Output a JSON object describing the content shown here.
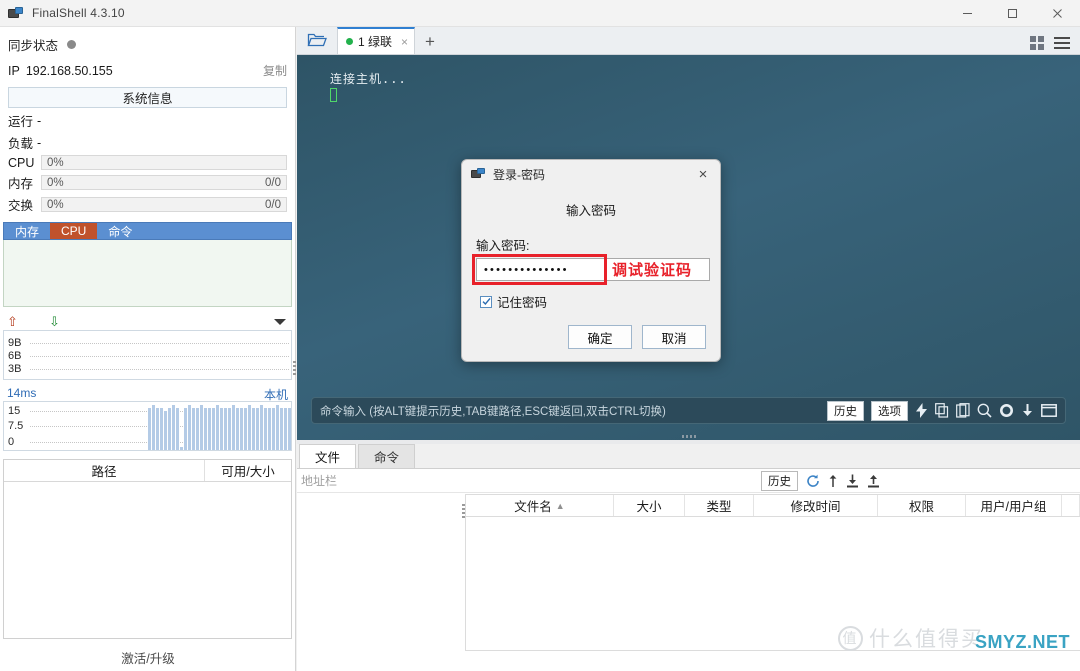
{
  "window": {
    "title": "FinalShell 4.3.10",
    "minimize_label": "minimize",
    "maximize_label": "maximize",
    "close_label": "close"
  },
  "sidebar": {
    "sync_label": "同步状态",
    "ip_prefix": "IP",
    "ip_value": "192.168.50.155",
    "copy_label": "复制",
    "sysinfo_button": "系统信息",
    "stats": [
      {
        "key": "运行",
        "value": "-"
      },
      {
        "key": "负载",
        "value": "-"
      }
    ],
    "bars": [
      {
        "key": "CPU",
        "percent": "0%",
        "right": ""
      },
      {
        "key": "内存",
        "percent": "0%",
        "right": "0/0"
      },
      {
        "key": "交换",
        "percent": "0%",
        "right": "0/0"
      }
    ],
    "mini_tabs": [
      {
        "label": "内存",
        "active": false
      },
      {
        "label": "CPU",
        "active": true
      },
      {
        "label": "命令",
        "active": false
      }
    ],
    "path_table": {
      "columns": [
        "路径",
        "可用/大小"
      ],
      "rows": []
    },
    "activate_label": "激活/升级"
  },
  "chart_data": [
    {
      "type": "line",
      "title": "",
      "name": "network-traffic",
      "ylabel": "",
      "xlabel": "",
      "ytick_labels": [
        "9B",
        "6B",
        "3B"
      ],
      "ytick_values": [
        9,
        6,
        3
      ],
      "ylim": [
        0,
        12
      ],
      "grid": true,
      "legend": [
        "上传",
        "下载"
      ],
      "legend_position": "top-left",
      "series": [
        {
          "name": "上传",
          "color": "#b33a1a",
          "values": []
        },
        {
          "name": "下载",
          "color": "#1f8a33",
          "values": []
        }
      ]
    },
    {
      "type": "bar",
      "name": "latency",
      "title": "14ms",
      "subtitle": "本机",
      "ylabel": "",
      "xlabel": "",
      "ytick_labels": [
        "15",
        "7.5",
        "0"
      ],
      "ytick_values": [
        15,
        7.5,
        0
      ],
      "ylim": [
        0,
        15
      ],
      "grid": true,
      "bar_color": "#b4cbe6",
      "categories": [],
      "values": [
        14,
        15,
        14,
        14,
        13,
        14,
        15,
        14,
        1,
        14,
        15,
        14,
        14,
        15,
        14,
        14,
        14,
        15,
        14,
        14,
        14,
        15,
        14,
        14,
        14,
        15,
        14,
        14,
        15,
        14,
        14,
        14,
        15,
        14,
        14,
        14
      ]
    }
  ],
  "network_chart": {
    "upload_icon": "arrow-up-icon",
    "download_icon": "arrow-down-icon",
    "menu_icon": "chevron-down-icon"
  },
  "latency_chart": {
    "value_label": "14ms",
    "host_label": "本机"
  },
  "terminal": {
    "folder_icon": "folder-open-icon",
    "tab": {
      "label": "1 绿联",
      "status": "connected",
      "close_label": "×"
    },
    "new_tab_label": "+",
    "grid_icon": "grid-view-icon",
    "menu_icon": "hamburger-menu-icon",
    "output_line": "连接主机...",
    "command_hint": "命令输入 (按ALT键提示历史,TAB键路径,ESC键返回,双击CTRL切换)",
    "history_button": "历史",
    "options_button": "选项",
    "icons": [
      "lightning-icon",
      "copy-icon",
      "paste-icon",
      "search-icon",
      "gear-icon",
      "download-icon",
      "window-icon"
    ],
    "background_color": "#35607a"
  },
  "file_panel": {
    "tabs": [
      {
        "label": "文件",
        "active": true
      },
      {
        "label": "命令",
        "active": false
      }
    ],
    "address_placeholder": "地址栏",
    "history_button": "历史",
    "toolbar_icons": [
      "refresh-icon",
      "upload-icon",
      "download-file-icon",
      "upload-file-icon"
    ],
    "columns": [
      "文件名",
      "大小",
      "类型",
      "修改时间",
      "权限",
      "用户/用户组"
    ],
    "sort_column": "文件名",
    "sort_direction": "asc",
    "rows": []
  },
  "dialog": {
    "title": "登录-密码",
    "close_label": "×",
    "heading": "输入密码",
    "field_label": "输入密码:",
    "password_value": "••••••••••••••",
    "annotation": "调试验证码",
    "annotation_color": "#e8212a",
    "remember_label": "记住密码",
    "remember_checked": true,
    "confirm_button": "确定",
    "cancel_button": "取消"
  },
  "watermark": {
    "brand_char": "值",
    "brand_text": "什么值得买",
    "site": "SMYZ.NET"
  }
}
